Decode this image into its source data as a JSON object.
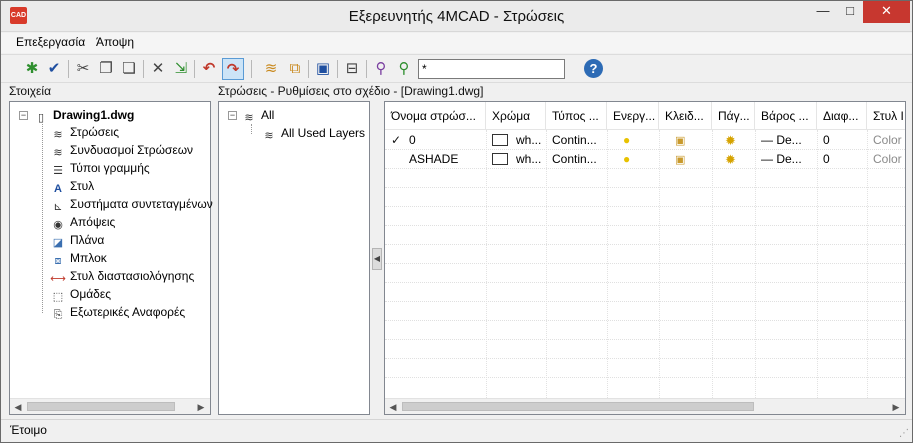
{
  "window": {
    "title": "Εξερευνητής 4MCAD - Στρώσεις",
    "app_icon": "CAD",
    "minimize": "—",
    "maximize": "□",
    "close": "✕"
  },
  "menu": [
    {
      "label": "Επεξεργασία"
    },
    {
      "label": "Άποψη"
    }
  ],
  "toolbar": {
    "icons": [
      "new-layer-icon",
      "check-icon",
      "cut-icon",
      "copy-icon",
      "paste-icon",
      "delete-icon",
      "export-icon",
      "undo-icon",
      "redo-icon",
      "layer-settings-icon",
      "layer-filter-icon",
      "layer-state-icon",
      "layer-print-icon",
      "filter-icon",
      "filter-apply-icon"
    ],
    "filter_value": "*",
    "help_label": "?"
  },
  "left_panel": {
    "header": "Στοιχεία",
    "root": {
      "label": "Drawing1.dwg"
    },
    "items": [
      {
        "label": "Στρώσεις",
        "icon": "layers-icon"
      },
      {
        "label": "Συνδυασμοί Στρώσεων",
        "icon": "layer-combinations-icon"
      },
      {
        "label": "Τύποι γραμμής",
        "icon": "linetypes-icon"
      },
      {
        "label": "Στυλ",
        "icon": "text-style-icon"
      },
      {
        "label": "Συστήματα συντεταγμένων",
        "icon": "coordinate-systems-icon"
      },
      {
        "label": "Απόψεις",
        "icon": "eye-icon"
      },
      {
        "label": "Πλάνα",
        "icon": "layouts-icon"
      },
      {
        "label": "Μπλοκ",
        "icon": "blocks-icon"
      },
      {
        "label": "Στυλ διαστασιολόγησης",
        "icon": "dimension-style-icon"
      },
      {
        "label": "Ομάδες",
        "icon": "groups-icon"
      },
      {
        "label": "Εξωτερικές Αναφορές",
        "icon": "xref-icon"
      }
    ]
  },
  "right_header": "Στρώσεις - Ρυθμίσεις στο σχέδιο - [Drawing1.dwg]",
  "middle_panel": {
    "items": [
      {
        "label": "All"
      },
      {
        "label": "All Used Layers"
      }
    ]
  },
  "layer_table": {
    "columns": [
      "Όνομα στρώσ...",
      "Χρώμα",
      "Τύπος ...",
      "Ενεργ...",
      "Κλειδ...",
      "Πάγ...",
      "Βάρος ...",
      "Διαφ...",
      "Στυλ Ι"
    ],
    "rows": [
      {
        "current": "✓",
        "name": "0",
        "color": "wh...",
        "linetype": "Contin...",
        "lineweight": "De...",
        "transparency": "0",
        "plot_style": "Color"
      },
      {
        "current": "",
        "name": "ASHADE",
        "color": "wh...",
        "linetype": "Contin...",
        "lineweight": "De...",
        "transparency": "0",
        "plot_style": "Color"
      }
    ]
  },
  "status": "Έτοιμο"
}
